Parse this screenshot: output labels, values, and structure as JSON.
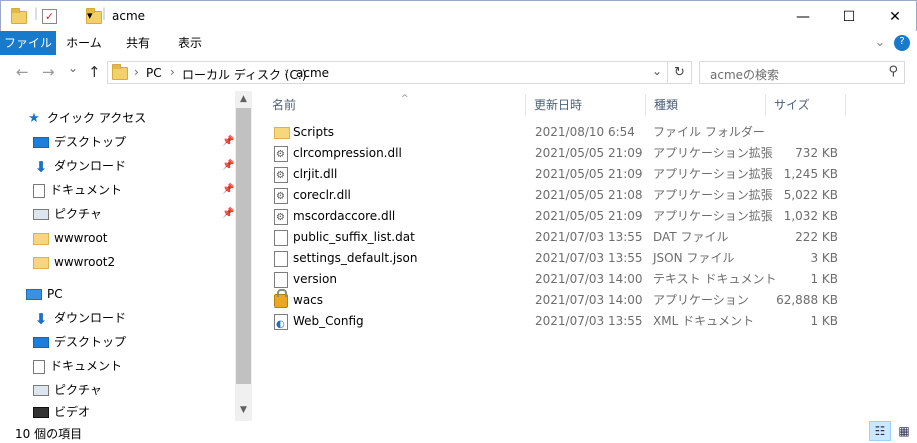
{
  "window": {
    "title": "acme",
    "minimize_glyph": "—",
    "maximize_glyph": "☐",
    "close_glyph": "✕"
  },
  "quick_access_toolbar": {
    "icons": [
      "folder-icon",
      "properties-check-icon",
      "new-folder-icon",
      "customize-dropdown-icon"
    ],
    "dropdown_glyph": "▾"
  },
  "ribbon": {
    "tabs": [
      {
        "label": "ファイル",
        "active": true
      },
      {
        "label": "ホーム"
      },
      {
        "label": "共有"
      },
      {
        "label": "表示"
      }
    ],
    "expand_glyph": "⌄",
    "help_glyph": "?"
  },
  "nav": {
    "back_glyph": "←",
    "forward_glyph": "→",
    "recent_glyph": "⌄",
    "up_glyph": "↑"
  },
  "address": {
    "path": [
      "PC",
      "ローカル ディスク (C:)",
      "acme"
    ],
    "separator": "›",
    "dropdown_glyph": "⌄",
    "refresh_glyph": "↻"
  },
  "search": {
    "placeholder": "acmeの検索",
    "icon_glyph": "⚲"
  },
  "sidebar": {
    "quick_access_label": "クイック アクセス",
    "quick_items": [
      {
        "label": "デスクトップ",
        "icon": "desktop-icon",
        "pinned": true
      },
      {
        "label": "ダウンロード",
        "icon": "download-icon",
        "pinned": true
      },
      {
        "label": "ドキュメント",
        "icon": "documents-icon",
        "pinned": true
      },
      {
        "label": "ピクチャ",
        "icon": "pictures-icon",
        "pinned": true
      },
      {
        "label": "wwwroot",
        "icon": "folder-icon",
        "pinned": false
      },
      {
        "label": "wwwroot2",
        "icon": "folder-icon",
        "pinned": false
      }
    ],
    "pc_label": "PC",
    "pc_items": [
      {
        "label": "ダウンロード",
        "icon": "download-icon"
      },
      {
        "label": "デスクトップ",
        "icon": "desktop-icon"
      },
      {
        "label": "ドキュメント",
        "icon": "documents-icon"
      },
      {
        "label": "ピクチャ",
        "icon": "pictures-icon"
      },
      {
        "label": "ビデオ",
        "icon": "videos-icon"
      }
    ],
    "pin_glyph": "📌",
    "star_glyph": "★",
    "down_glyph": "⬇",
    "scroll_up_glyph": "▲",
    "scroll_down_glyph": "▼"
  },
  "columns": {
    "name": "名前",
    "date": "更新日時",
    "type": "種類",
    "size": "サイズ",
    "sort_glyph": "^"
  },
  "files": [
    {
      "name": "Scripts",
      "date": "2021/08/10 6:54",
      "type": "ファイル フォルダー",
      "size": "",
      "icon": "folder-icon"
    },
    {
      "name": "clrcompression.dll",
      "date": "2021/05/05 21:09",
      "type": "アプリケーション拡張",
      "size": "732 KB",
      "icon": "dll-icon"
    },
    {
      "name": "clrjit.dll",
      "date": "2021/05/05 21:09",
      "type": "アプリケーション拡張",
      "size": "1,245 KB",
      "icon": "dll-icon"
    },
    {
      "name": "coreclr.dll",
      "date": "2021/05/05 21:08",
      "type": "アプリケーション拡張",
      "size": "5,022 KB",
      "icon": "dll-icon"
    },
    {
      "name": "mscordaccore.dll",
      "date": "2021/05/05 21:09",
      "type": "アプリケーション拡張",
      "size": "1,032 KB",
      "icon": "dll-icon"
    },
    {
      "name": "public_suffix_list.dat",
      "date": "2021/07/03 13:55",
      "type": "DAT ファイル",
      "size": "222 KB",
      "icon": "file-icon"
    },
    {
      "name": "settings_default.json",
      "date": "2021/07/03 13:55",
      "type": "JSON ファイル",
      "size": "3 KB",
      "icon": "file-icon"
    },
    {
      "name": "version",
      "date": "2021/07/03 14:00",
      "type": "テキスト ドキュメント",
      "size": "1 KB",
      "icon": "file-icon"
    },
    {
      "name": "wacs",
      "date": "2021/07/03 14:00",
      "type": "アプリケーション",
      "size": "62,888 KB",
      "icon": "lock-app-icon"
    },
    {
      "name": "Web_Config",
      "date": "2021/07/03 13:55",
      "type": "XML ドキュメント",
      "size": "1 KB",
      "icon": "xml-icon"
    }
  ],
  "status": {
    "item_count": "10 個の項目",
    "details_view_glyph": "☷",
    "large_icons_glyph": "▦"
  },
  "colors": {
    "accent": "#1979ca",
    "selection": "#cce8ff",
    "header_text": "#4c607a"
  }
}
